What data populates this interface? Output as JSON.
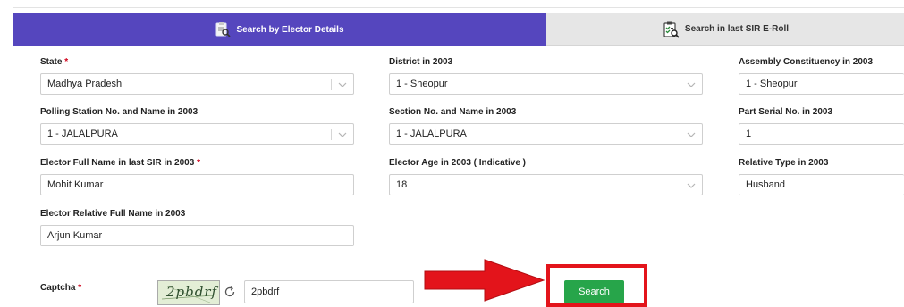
{
  "tabs": [
    {
      "label": "Search by Elector Details",
      "active": true
    },
    {
      "label": "Search in last SIR E-Roll",
      "active": false
    }
  ],
  "form": {
    "state": {
      "label": "State",
      "required": true,
      "value": "Madhya Pradesh"
    },
    "district": {
      "label": "District in 2003",
      "value": "1 - Sheopur"
    },
    "assembly": {
      "label": "Assembly Constituency in 2003",
      "value": "1 - Sheopur"
    },
    "polling_station": {
      "label": "Polling Station No. and Name in 2003",
      "value": "1 - JALALPURA"
    },
    "section": {
      "label": "Section No. and Name in 2003",
      "value": "1 - JALALPURA"
    },
    "part_serial": {
      "label": "Part Serial No. in 2003",
      "value": "1"
    },
    "elector_name": {
      "label": "Elector Full Name in last SIR in 2003",
      "required": true,
      "value": "Mohit Kumar"
    },
    "elector_age": {
      "label": "Elector Age in 2003 ( Indicative )",
      "value": "18"
    },
    "relative_type": {
      "label": "Relative Type in 2003",
      "value": "Husband"
    },
    "relative_name": {
      "label": "Elector Relative Full Name in 2003",
      "value": "Arjun Kumar"
    },
    "captcha": {
      "label": "Captcha",
      "required": true,
      "image_text": "2pbdrf",
      "value": "2pbdrf"
    },
    "required_mark": "*"
  },
  "search_button": {
    "label": "Search"
  },
  "colors": {
    "tab_active": "#5546be",
    "tab_inactive": "#e6e6e6",
    "search_button": "#27a54a",
    "annotation": "#e3141b"
  },
  "icons": {
    "tab_active": "clipboard-search-icon",
    "tab_inactive": "clipboard-check-search-icon",
    "refresh": "refresh-icon",
    "dropdown": "chevron-down-icon",
    "annotation": "red-arrow-icon"
  }
}
